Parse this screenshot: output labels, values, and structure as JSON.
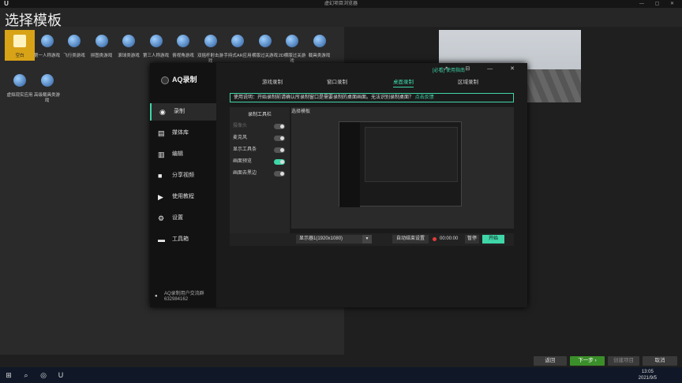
{
  "ue": {
    "window_title": "虚幻项目浏览器",
    "heading": "选择模板",
    "templates": [
      {
        "label": "空白",
        "selected": true
      },
      {
        "label": "第一人称游戏"
      },
      {
        "label": "飞行类游戏"
      },
      {
        "label": "拼图类游戏"
      },
      {
        "label": "滚球类游戏"
      },
      {
        "label": "第三人称游戏"
      },
      {
        "label": "俯视角游戏"
      },
      {
        "label": "双摇杆射击游戏"
      },
      {
        "label": "手持式AR应用"
      },
      {
        "label": "横版过关游戏"
      },
      {
        "label": "2D横版过关游戏"
      },
      {
        "label": "载具类游戏"
      },
      {
        "label": "虚拟现实应用"
      },
      {
        "label": "高级载具类游戏"
      }
    ],
    "buttons": {
      "back": "返回",
      "next": "下一步 ›",
      "create": "创建项目",
      "cancel": "取消"
    }
  },
  "taskbar": {
    "time": "13:05",
    "date": "2021/9/5"
  },
  "aq": {
    "logo": "AQ录制",
    "nav": [
      {
        "label": "录制",
        "icon": "◉"
      },
      {
        "label": "媒体库",
        "icon": "▤"
      },
      {
        "label": "编辑",
        "icon": "▥"
      },
      {
        "label": "分享视频",
        "icon": "■"
      },
      {
        "label": "使用教程",
        "icon": "▶"
      },
      {
        "label": "设置",
        "icon": "⚙"
      },
      {
        "label": "工具箱",
        "icon": "▬"
      }
    ],
    "footer_line1": "AQ录制用户交流群",
    "footer_line2": "632984162",
    "guide": "[必看] 使用指南",
    "tabs": [
      "游戏录制",
      "窗口录制",
      "桌面录制",
      "区域录制"
    ],
    "active_tab": "桌面录制",
    "tip_text": "使用说明：开始录制前请确认所录制窗口是需要录制的桌面画面。无法识别录制桌面？",
    "tip_link": "点击反馈",
    "toolbar_title": "录制工具栏",
    "tool_rows": [
      {
        "label": "摄像头",
        "on": false,
        "dim": true
      },
      {
        "label": "麦克风",
        "on": false
      },
      {
        "label": "显示工具条",
        "on": false
      },
      {
        "label": "画面预览",
        "on": true
      },
      {
        "label": "画面去黑边",
        "on": false
      }
    ],
    "preview_label": "选择模板",
    "display_select": "显示器1(1920x1080)",
    "auto_stop": "自动结束设置",
    "timer": "00:00:00",
    "pause": "暂停",
    "start": "开始"
  }
}
